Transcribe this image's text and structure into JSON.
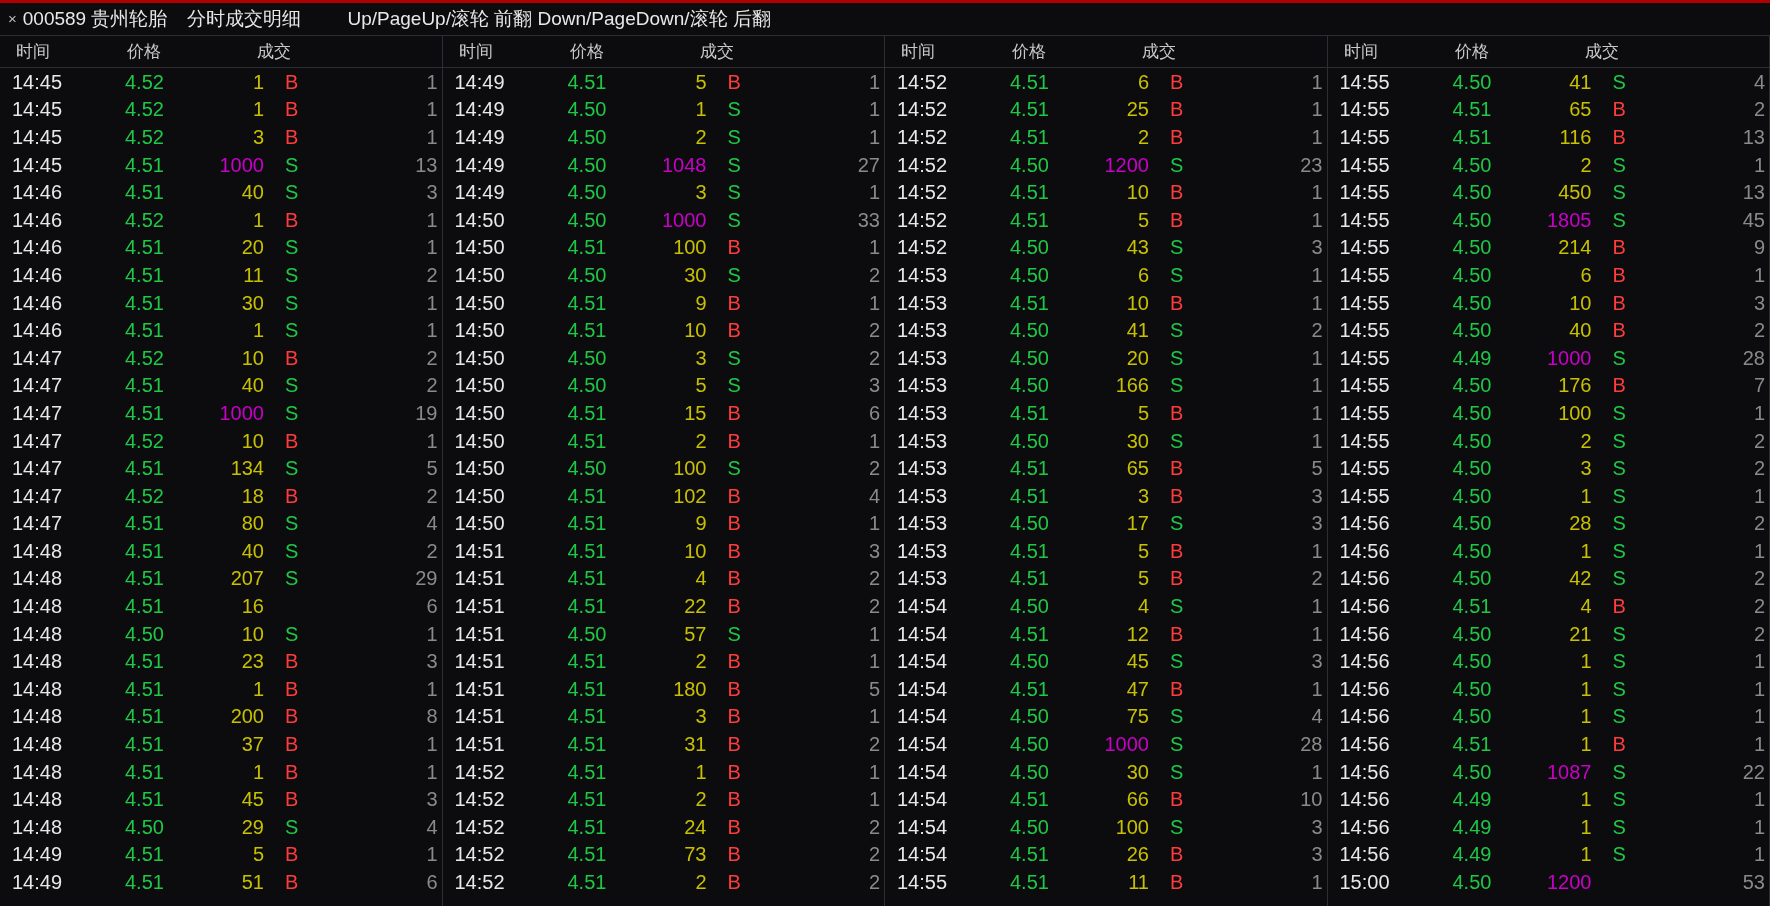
{
  "title_bar": {
    "close": "×",
    "stock": "000589 贵州轮胎",
    "view": "分时成交明细",
    "hint": "Up/PageUp/滚轮 前翻 Down/PageDown/滚轮 后翻"
  },
  "panels": [
    {
      "headers": [
        "时间",
        "价格",
        "成交"
      ],
      "rows": [
        {
          "time": "14:45",
          "price": "4.52",
          "volume": "1",
          "big": false,
          "side": "B",
          "kind": "buy",
          "count": "1"
        },
        {
          "time": "14:45",
          "price": "4.52",
          "volume": "1",
          "big": false,
          "side": "B",
          "kind": "buy",
          "count": "1"
        },
        {
          "time": "14:45",
          "price": "4.52",
          "volume": "3",
          "big": false,
          "side": "B",
          "kind": "buy",
          "count": "1"
        },
        {
          "time": "14:45",
          "price": "4.51",
          "volume": "1000",
          "big": true,
          "side": "S",
          "kind": "sell",
          "count": "13"
        },
        {
          "time": "14:46",
          "price": "4.51",
          "volume": "40",
          "big": false,
          "side": "S",
          "kind": "sell",
          "count": "3"
        },
        {
          "time": "14:46",
          "price": "4.52",
          "volume": "1",
          "big": false,
          "side": "B",
          "kind": "buy",
          "count": "1"
        },
        {
          "time": "14:46",
          "price": "4.51",
          "volume": "20",
          "big": false,
          "side": "S",
          "kind": "sell",
          "count": "1"
        },
        {
          "time": "14:46",
          "price": "4.51",
          "volume": "11",
          "big": false,
          "side": "S",
          "kind": "sell",
          "count": "2"
        },
        {
          "time": "14:46",
          "price": "4.51",
          "volume": "30",
          "big": false,
          "side": "S",
          "kind": "sell",
          "count": "1"
        },
        {
          "time": "14:46",
          "price": "4.51",
          "volume": "1",
          "big": false,
          "side": "S",
          "kind": "sell",
          "count": "1"
        },
        {
          "time": "14:47",
          "price": "4.52",
          "volume": "10",
          "big": false,
          "side": "B",
          "kind": "buy",
          "count": "2"
        },
        {
          "time": "14:47",
          "price": "4.51",
          "volume": "40",
          "big": false,
          "side": "S",
          "kind": "sell",
          "count": "2"
        },
        {
          "time": "14:47",
          "price": "4.51",
          "volume": "1000",
          "big": true,
          "side": "S",
          "kind": "sell",
          "count": "19"
        },
        {
          "time": "14:47",
          "price": "4.52",
          "volume": "10",
          "big": false,
          "side": "B",
          "kind": "buy",
          "count": "1"
        },
        {
          "time": "14:47",
          "price": "4.51",
          "volume": "134",
          "big": false,
          "side": "S",
          "kind": "sell",
          "count": "5"
        },
        {
          "time": "14:47",
          "price": "4.52",
          "volume": "18",
          "big": false,
          "side": "B",
          "kind": "buy",
          "count": "2"
        },
        {
          "time": "14:47",
          "price": "4.51",
          "volume": "80",
          "big": false,
          "side": "S",
          "kind": "sell",
          "count": "4"
        },
        {
          "time": "14:48",
          "price": "4.51",
          "volume": "40",
          "big": false,
          "side": "S",
          "kind": "sell",
          "count": "2"
        },
        {
          "time": "14:48",
          "price": "4.51",
          "volume": "207",
          "big": false,
          "side": "S",
          "kind": "sell",
          "count": "29"
        },
        {
          "time": "14:48",
          "price": "4.51",
          "volume": "16",
          "big": false,
          "kind": "none",
          "count": "6"
        },
        {
          "time": "14:48",
          "price": "4.50",
          "volume": "10",
          "big": false,
          "side": "S",
          "kind": "sell",
          "count": "1"
        },
        {
          "time": "14:48",
          "price": "4.51",
          "volume": "23",
          "big": false,
          "side": "B",
          "kind": "buy",
          "count": "3"
        },
        {
          "time": "14:48",
          "price": "4.51",
          "volume": "1",
          "big": false,
          "side": "B",
          "kind": "buy",
          "count": "1"
        },
        {
          "time": "14:48",
          "price": "4.51",
          "volume": "200",
          "big": false,
          "side": "B",
          "kind": "buy",
          "count": "8"
        },
        {
          "time": "14:48",
          "price": "4.51",
          "volume": "37",
          "big": false,
          "side": "B",
          "kind": "buy",
          "count": "1"
        },
        {
          "time": "14:48",
          "price": "4.51",
          "volume": "1",
          "big": false,
          "side": "B",
          "kind": "buy",
          "count": "1"
        },
        {
          "time": "14:48",
          "price": "4.51",
          "volume": "45",
          "big": false,
          "side": "B",
          "kind": "buy",
          "count": "3"
        },
        {
          "time": "14:48",
          "price": "4.50",
          "volume": "29",
          "big": false,
          "side": "S",
          "kind": "sell",
          "count": "4"
        },
        {
          "time": "14:49",
          "price": "4.51",
          "volume": "5",
          "big": false,
          "side": "B",
          "kind": "buy",
          "count": "1"
        },
        {
          "time": "14:49",
          "price": "4.51",
          "volume": "51",
          "big": false,
          "side": "B",
          "kind": "buy",
          "count": "6"
        }
      ]
    },
    {
      "headers": [
        "时间",
        "价格",
        "成交"
      ],
      "rows": [
        {
          "time": "14:49",
          "price": "4.51",
          "volume": "5",
          "big": false,
          "side": "B",
          "kind": "buy",
          "count": "1"
        },
        {
          "time": "14:49",
          "price": "4.50",
          "volume": "1",
          "big": false,
          "side": "S",
          "kind": "sell",
          "count": "1"
        },
        {
          "time": "14:49",
          "price": "4.50",
          "volume": "2",
          "big": false,
          "side": "S",
          "kind": "sell",
          "count": "1"
        },
        {
          "time": "14:49",
          "price": "4.50",
          "volume": "1048",
          "big": true,
          "side": "S",
          "kind": "sell",
          "count": "27"
        },
        {
          "time": "14:49",
          "price": "4.50",
          "volume": "3",
          "big": false,
          "side": "S",
          "kind": "sell",
          "count": "1"
        },
        {
          "time": "14:50",
          "price": "4.50",
          "volume": "1000",
          "big": true,
          "side": "S",
          "kind": "sell",
          "count": "33"
        },
        {
          "time": "14:50",
          "price": "4.51",
          "volume": "100",
          "big": false,
          "side": "B",
          "kind": "buy",
          "count": "1"
        },
        {
          "time": "14:50",
          "price": "4.50",
          "volume": "30",
          "big": false,
          "side": "S",
          "kind": "sell",
          "count": "2"
        },
        {
          "time": "14:50",
          "price": "4.51",
          "volume": "9",
          "big": false,
          "side": "B",
          "kind": "buy",
          "count": "1"
        },
        {
          "time": "14:50",
          "price": "4.51",
          "volume": "10",
          "big": false,
          "side": "B",
          "kind": "buy",
          "count": "2"
        },
        {
          "time": "14:50",
          "price": "4.50",
          "volume": "3",
          "big": false,
          "side": "S",
          "kind": "sell",
          "count": "2"
        },
        {
          "time": "14:50",
          "price": "4.50",
          "volume": "5",
          "big": false,
          "side": "S",
          "kind": "sell",
          "count": "3"
        },
        {
          "time": "14:50",
          "price": "4.51",
          "volume": "15",
          "big": false,
          "side": "B",
          "kind": "buy",
          "count": "6"
        },
        {
          "time": "14:50",
          "price": "4.51",
          "volume": "2",
          "big": false,
          "side": "B",
          "kind": "buy",
          "count": "1"
        },
        {
          "time": "14:50",
          "price": "4.50",
          "volume": "100",
          "big": false,
          "side": "S",
          "kind": "sell",
          "count": "2"
        },
        {
          "time": "14:50",
          "price": "4.51",
          "volume": "102",
          "big": false,
          "side": "B",
          "kind": "buy",
          "count": "4"
        },
        {
          "time": "14:50",
          "price": "4.51",
          "volume": "9",
          "big": false,
          "side": "B",
          "kind": "buy",
          "count": "1"
        },
        {
          "time": "14:51",
          "price": "4.51",
          "volume": "10",
          "big": false,
          "side": "B",
          "kind": "buy",
          "count": "3"
        },
        {
          "time": "14:51",
          "price": "4.51",
          "volume": "4",
          "big": false,
          "side": "B",
          "kind": "buy",
          "count": "2"
        },
        {
          "time": "14:51",
          "price": "4.51",
          "volume": "22",
          "big": false,
          "side": "B",
          "kind": "buy",
          "count": "2"
        },
        {
          "time": "14:51",
          "price": "4.50",
          "volume": "57",
          "big": false,
          "side": "S",
          "kind": "sell",
          "count": "1"
        },
        {
          "time": "14:51",
          "price": "4.51",
          "volume": "2",
          "big": false,
          "side": "B",
          "kind": "buy",
          "count": "1"
        },
        {
          "time": "14:51",
          "price": "4.51",
          "volume": "180",
          "big": false,
          "side": "B",
          "kind": "buy",
          "count": "5"
        },
        {
          "time": "14:51",
          "price": "4.51",
          "volume": "3",
          "big": false,
          "side": "B",
          "kind": "buy",
          "count": "1"
        },
        {
          "time": "14:51",
          "price": "4.51",
          "volume": "31",
          "big": false,
          "side": "B",
          "kind": "buy",
          "count": "2"
        },
        {
          "time": "14:52",
          "price": "4.51",
          "volume": "1",
          "big": false,
          "side": "B",
          "kind": "buy",
          "count": "1"
        },
        {
          "time": "14:52",
          "price": "4.51",
          "volume": "2",
          "big": false,
          "side": "B",
          "kind": "buy",
          "count": "1"
        },
        {
          "time": "14:52",
          "price": "4.51",
          "volume": "24",
          "big": false,
          "side": "B",
          "kind": "buy",
          "count": "2"
        },
        {
          "time": "14:52",
          "price": "4.51",
          "volume": "73",
          "big": false,
          "side": "B",
          "kind": "buy",
          "count": "2"
        },
        {
          "time": "14:52",
          "price": "4.51",
          "volume": "2",
          "big": false,
          "side": "B",
          "kind": "buy",
          "count": "2"
        }
      ]
    },
    {
      "headers": [
        "时间",
        "价格",
        "成交"
      ],
      "rows": [
        {
          "time": "14:52",
          "price": "4.51",
          "volume": "6",
          "big": false,
          "side": "B",
          "kind": "buy",
          "count": "1"
        },
        {
          "time": "14:52",
          "price": "4.51",
          "volume": "25",
          "big": false,
          "side": "B",
          "kind": "buy",
          "count": "1"
        },
        {
          "time": "14:52",
          "price": "4.51",
          "volume": "2",
          "big": false,
          "side": "B",
          "kind": "buy",
          "count": "1"
        },
        {
          "time": "14:52",
          "price": "4.50",
          "volume": "1200",
          "big": true,
          "side": "S",
          "kind": "sell",
          "count": "23"
        },
        {
          "time": "14:52",
          "price": "4.51",
          "volume": "10",
          "big": false,
          "side": "B",
          "kind": "buy",
          "count": "1"
        },
        {
          "time": "14:52",
          "price": "4.51",
          "volume": "5",
          "big": false,
          "side": "B",
          "kind": "buy",
          "count": "1"
        },
        {
          "time": "14:52",
          "price": "4.50",
          "volume": "43",
          "big": false,
          "side": "S",
          "kind": "sell",
          "count": "3"
        },
        {
          "time": "14:53",
          "price": "4.50",
          "volume": "6",
          "big": false,
          "side": "S",
          "kind": "sell",
          "count": "1"
        },
        {
          "time": "14:53",
          "price": "4.51",
          "volume": "10",
          "big": false,
          "side": "B",
          "kind": "buy",
          "count": "1"
        },
        {
          "time": "14:53",
          "price": "4.50",
          "volume": "41",
          "big": false,
          "side": "S",
          "kind": "sell",
          "count": "2"
        },
        {
          "time": "14:53",
          "price": "4.50",
          "volume": "20",
          "big": false,
          "side": "S",
          "kind": "sell",
          "count": "1"
        },
        {
          "time": "14:53",
          "price": "4.50",
          "volume": "166",
          "big": false,
          "side": "S",
          "kind": "sell",
          "count": "1"
        },
        {
          "time": "14:53",
          "price": "4.51",
          "volume": "5",
          "big": false,
          "side": "B",
          "kind": "buy",
          "count": "1"
        },
        {
          "time": "14:53",
          "price": "4.50",
          "volume": "30",
          "big": false,
          "side": "S",
          "kind": "sell",
          "count": "1"
        },
        {
          "time": "14:53",
          "price": "4.51",
          "volume": "65",
          "big": false,
          "side": "B",
          "kind": "buy",
          "count": "5"
        },
        {
          "time": "14:53",
          "price": "4.51",
          "volume": "3",
          "big": false,
          "side": "B",
          "kind": "buy",
          "count": "3"
        },
        {
          "time": "14:53",
          "price": "4.50",
          "volume": "17",
          "big": false,
          "side": "S",
          "kind": "sell",
          "count": "3"
        },
        {
          "time": "14:53",
          "price": "4.51",
          "volume": "5",
          "big": false,
          "side": "B",
          "kind": "buy",
          "count": "1"
        },
        {
          "time": "14:53",
          "price": "4.51",
          "volume": "5",
          "big": false,
          "side": "B",
          "kind": "buy",
          "count": "2"
        },
        {
          "time": "14:54",
          "price": "4.50",
          "volume": "4",
          "big": false,
          "side": "S",
          "kind": "sell",
          "count": "1"
        },
        {
          "time": "14:54",
          "price": "4.51",
          "volume": "12",
          "big": false,
          "side": "B",
          "kind": "buy",
          "count": "1"
        },
        {
          "time": "14:54",
          "price": "4.50",
          "volume": "45",
          "big": false,
          "side": "S",
          "kind": "sell",
          "count": "3"
        },
        {
          "time": "14:54",
          "price": "4.51",
          "volume": "47",
          "big": false,
          "side": "B",
          "kind": "buy",
          "count": "1"
        },
        {
          "time": "14:54",
          "price": "4.50",
          "volume": "75",
          "big": false,
          "side": "S",
          "kind": "sell",
          "count": "4"
        },
        {
          "time": "14:54",
          "price": "4.50",
          "volume": "1000",
          "big": true,
          "side": "S",
          "kind": "sell",
          "count": "28"
        },
        {
          "time": "14:54",
          "price": "4.50",
          "volume": "30",
          "big": false,
          "side": "S",
          "kind": "sell",
          "count": "1"
        },
        {
          "time": "14:54",
          "price": "4.51",
          "volume": "66",
          "big": false,
          "side": "B",
          "kind": "buy",
          "count": "10"
        },
        {
          "time": "14:54",
          "price": "4.50",
          "volume": "100",
          "big": false,
          "side": "S",
          "kind": "sell",
          "count": "3"
        },
        {
          "time": "14:54",
          "price": "4.51",
          "volume": "26",
          "big": false,
          "side": "B",
          "kind": "buy",
          "count": "3"
        },
        {
          "time": "14:55",
          "price": "4.51",
          "volume": "11",
          "big": false,
          "side": "B",
          "kind": "buy",
          "count": "1"
        }
      ]
    },
    {
      "headers": [
        "时间",
        "价格",
        "成交"
      ],
      "rows": [
        {
          "time": "14:55",
          "price": "4.50",
          "volume": "41",
          "big": false,
          "side": "S",
          "kind": "sell",
          "count": "4"
        },
        {
          "time": "14:55",
          "price": "4.51",
          "volume": "65",
          "big": false,
          "side": "B",
          "kind": "buy",
          "count": "2"
        },
        {
          "time": "14:55",
          "price": "4.51",
          "volume": "116",
          "big": false,
          "side": "B",
          "kind": "buy",
          "count": "13"
        },
        {
          "time": "14:55",
          "price": "4.50",
          "volume": "2",
          "big": false,
          "side": "S",
          "kind": "sell",
          "count": "1"
        },
        {
          "time": "14:55",
          "price": "4.50",
          "volume": "450",
          "big": false,
          "side": "S",
          "kind": "sell",
          "count": "13"
        },
        {
          "time": "14:55",
          "price": "4.50",
          "volume": "1805",
          "big": true,
          "side": "S",
          "kind": "sell",
          "count": "45"
        },
        {
          "time": "14:55",
          "price": "4.50",
          "volume": "214",
          "big": false,
          "side": "B",
          "kind": "buy",
          "count": "9"
        },
        {
          "time": "14:55",
          "price": "4.50",
          "volume": "6",
          "big": false,
          "side": "B",
          "kind": "buy",
          "count": "1"
        },
        {
          "time": "14:55",
          "price": "4.50",
          "volume": "10",
          "big": false,
          "side": "B",
          "kind": "buy",
          "count": "3"
        },
        {
          "time": "14:55",
          "price": "4.50",
          "volume": "40",
          "big": false,
          "side": "B",
          "kind": "buy",
          "count": "2"
        },
        {
          "time": "14:55",
          "price": "4.49",
          "volume": "1000",
          "big": true,
          "side": "S",
          "kind": "sell",
          "count": "28"
        },
        {
          "time": "14:55",
          "price": "4.50",
          "volume": "176",
          "big": false,
          "side": "B",
          "kind": "buy",
          "count": "7"
        },
        {
          "time": "14:55",
          "price": "4.50",
          "volume": "100",
          "big": false,
          "side": "S",
          "kind": "sell",
          "count": "1"
        },
        {
          "time": "14:55",
          "price": "4.50",
          "volume": "2",
          "big": false,
          "side": "S",
          "kind": "sell",
          "count": "2"
        },
        {
          "time": "14:55",
          "price": "4.50",
          "volume": "3",
          "big": false,
          "side": "S",
          "kind": "sell",
          "count": "2"
        },
        {
          "time": "14:55",
          "price": "4.50",
          "volume": "1",
          "big": false,
          "side": "S",
          "kind": "sell",
          "count": "1"
        },
        {
          "time": "14:56",
          "price": "4.50",
          "volume": "28",
          "big": false,
          "side": "S",
          "kind": "sell",
          "count": "2"
        },
        {
          "time": "14:56",
          "price": "4.50",
          "volume": "1",
          "big": false,
          "side": "S",
          "kind": "sell",
          "count": "1"
        },
        {
          "time": "14:56",
          "price": "4.50",
          "volume": "42",
          "big": false,
          "side": "S",
          "kind": "sell",
          "count": "2"
        },
        {
          "time": "14:56",
          "price": "4.51",
          "volume": "4",
          "big": false,
          "side": "B",
          "kind": "buy",
          "count": "2"
        },
        {
          "time": "14:56",
          "price": "4.50",
          "volume": "21",
          "big": false,
          "side": "S",
          "kind": "sell",
          "count": "2"
        },
        {
          "time": "14:56",
          "price": "4.50",
          "volume": "1",
          "big": false,
          "side": "S",
          "kind": "sell",
          "count": "1"
        },
        {
          "time": "14:56",
          "price": "4.50",
          "volume": "1",
          "big": false,
          "side": "S",
          "kind": "sell",
          "count": "1"
        },
        {
          "time": "14:56",
          "price": "4.50",
          "volume": "1",
          "big": false,
          "side": "S",
          "kind": "sell",
          "count": "1"
        },
        {
          "time": "14:56",
          "price": "4.51",
          "volume": "1",
          "big": false,
          "side": "B",
          "kind": "buy",
          "count": "1"
        },
        {
          "time": "14:56",
          "price": "4.50",
          "volume": "1087",
          "big": true,
          "side": "S",
          "kind": "sell",
          "count": "22"
        },
        {
          "time": "14:56",
          "price": "4.49",
          "volume": "1",
          "big": false,
          "side": "S",
          "kind": "sell",
          "count": "1"
        },
        {
          "time": "14:56",
          "price": "4.49",
          "volume": "1",
          "big": false,
          "side": "S",
          "kind": "sell",
          "count": "1"
        },
        {
          "time": "14:56",
          "price": "4.49",
          "volume": "1",
          "big": false,
          "side": "S",
          "kind": "sell",
          "count": "1"
        },
        {
          "time": "15:00",
          "price": "4.50",
          "volume": "1200",
          "big": true,
          "kind": "none",
          "count": "53"
        }
      ]
    }
  ]
}
